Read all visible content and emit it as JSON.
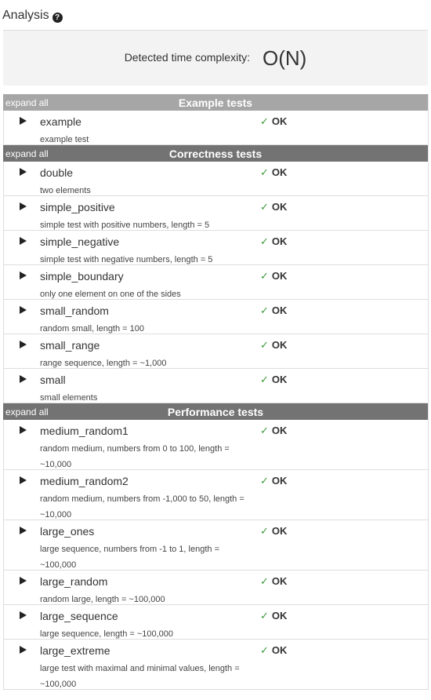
{
  "header": {
    "title": "Analysis",
    "help_icon": "?"
  },
  "complexity": {
    "label": "Detected time complexity:",
    "value": "O(N)"
  },
  "status_check": "✓",
  "groups": [
    {
      "expand_label": "expand all",
      "title": "Example tests",
      "tests": [
        {
          "name": "example",
          "description": "example test",
          "status": "OK"
        }
      ]
    },
    {
      "expand_label": "expand all",
      "title": "Correctness tests",
      "tests": [
        {
          "name": "double",
          "description": "two elements",
          "status": "OK"
        },
        {
          "name": "simple_positive",
          "description": "simple test with positive numbers, length = 5",
          "status": "OK"
        },
        {
          "name": "simple_negative",
          "description": "simple test with negative numbers, length = 5",
          "status": "OK"
        },
        {
          "name": "simple_boundary",
          "description": "only one element on one of the sides",
          "status": "OK"
        },
        {
          "name": "small_random",
          "description": "random small, length = 100",
          "status": "OK"
        },
        {
          "name": "small_range",
          "description": "range sequence, length = ~1,000",
          "status": "OK"
        },
        {
          "name": "small",
          "description": "small elements",
          "status": "OK"
        }
      ]
    },
    {
      "expand_label": "expand all",
      "title": "Performance tests",
      "tests": [
        {
          "name": "medium_random1",
          "description": "random medium, numbers from 0 to 100, length = ~10,000",
          "status": "OK"
        },
        {
          "name": "medium_random2",
          "description": "random medium, numbers from -1,000 to 50, length = ~10,000",
          "status": "OK"
        },
        {
          "name": "large_ones",
          "description": "large sequence, numbers from -1 to 1, length = ~100,000",
          "status": "OK"
        },
        {
          "name": "large_random",
          "description": "random large, length = ~100,000",
          "status": "OK"
        },
        {
          "name": "large_sequence",
          "description": "large sequence, length = ~100,000",
          "status": "OK"
        },
        {
          "name": "large_extreme",
          "description": "large test with maximal and minimal values, length = ~100,000",
          "status": "OK"
        }
      ]
    }
  ]
}
